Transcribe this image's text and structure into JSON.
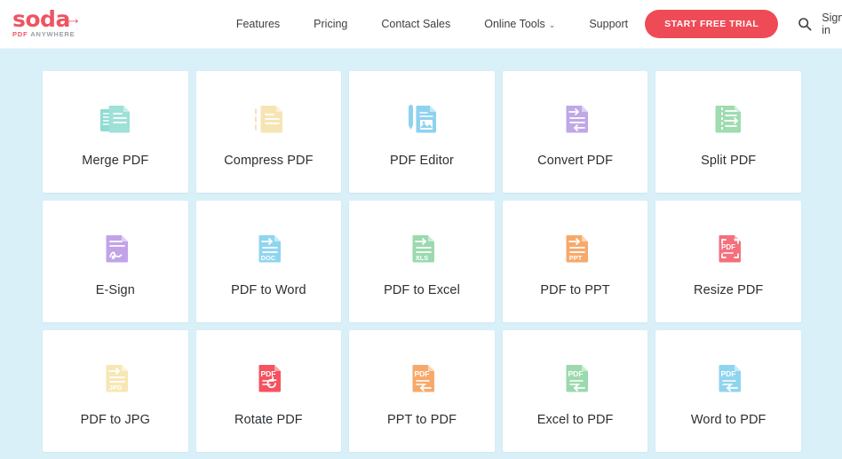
{
  "header": {
    "logo": {
      "word": "soda",
      "arrow": "→",
      "sub_pdf": "PDF",
      "sub_anywhere": "ANYWHERE"
    },
    "nav": [
      {
        "label": "Features",
        "has_caret": false
      },
      {
        "label": "Pricing",
        "has_caret": false
      },
      {
        "label": "Contact Sales",
        "has_caret": false
      },
      {
        "label": "Online Tools",
        "has_caret": true,
        "caret": "⌄"
      },
      {
        "label": "Support",
        "has_caret": false
      }
    ],
    "cta_label": "START FREE TRIAL",
    "search_icon": "search-icon",
    "signin_label": "Sign in",
    "cta_color": "#ef4b57",
    "brand_color": "#ef5462"
  },
  "page": {
    "background_color": "#d9f0f9",
    "card_background": "#ffffff"
  },
  "tools": [
    {
      "label": "Merge PDF",
      "icon": "merge-pdf-icon",
      "color": "#8fdcd2"
    },
    {
      "label": "Compress PDF",
      "icon": "compress-pdf-icon",
      "color": "#f6e5b4"
    },
    {
      "label": "PDF Editor",
      "icon": "pdf-editor-icon",
      "color": "#8ed2ef"
    },
    {
      "label": "Convert PDF",
      "icon": "convert-pdf-icon",
      "color": "#bfa7e8"
    },
    {
      "label": "Split PDF",
      "icon": "split-pdf-icon",
      "color": "#9fdcb0"
    },
    {
      "label": "E-Sign",
      "icon": "e-sign-icon",
      "color": "#c3a3e8"
    },
    {
      "label": "PDF to Word",
      "icon": "pdf-to-word-icon",
      "color": "#8fd5ef",
      "badge": "DOC"
    },
    {
      "label": "PDF to Excel",
      "icon": "pdf-to-excel-icon",
      "color": "#9bd9ae",
      "badge": "XLS"
    },
    {
      "label": "PDF to PPT",
      "icon": "pdf-to-ppt-icon",
      "color": "#f6a96b",
      "badge": "PPT"
    },
    {
      "label": "Resize PDF",
      "icon": "resize-pdf-icon",
      "color": "#f4707c",
      "badge": "PDF"
    },
    {
      "label": "PDF to JPG",
      "icon": "pdf-to-jpg-icon",
      "color": "#f7e7b5",
      "badge": "JPG"
    },
    {
      "label": "Rotate PDF",
      "icon": "rotate-pdf-icon",
      "color": "#f4535f",
      "badge": "PDF"
    },
    {
      "label": "PPT to PDF",
      "icon": "ppt-to-pdf-icon",
      "color": "#f6a96b",
      "badge": "PDF"
    },
    {
      "label": "Excel to PDF",
      "icon": "excel-to-pdf-icon",
      "color": "#9bd9ae",
      "badge": "PDF"
    },
    {
      "label": "Word to PDF",
      "icon": "word-to-pdf-icon",
      "color": "#8fd5ef",
      "badge": "PDF"
    }
  ]
}
